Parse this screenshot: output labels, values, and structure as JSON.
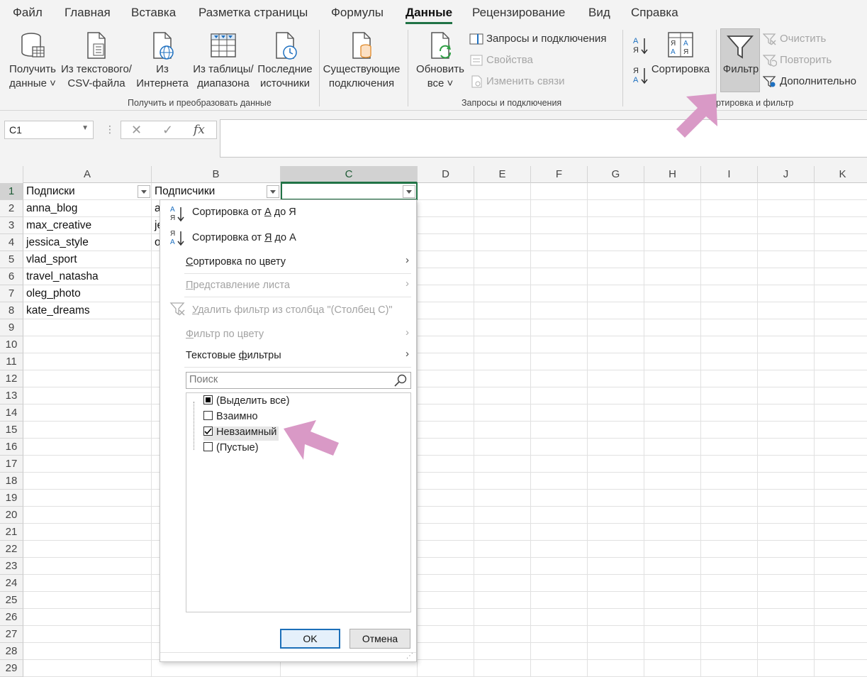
{
  "menu": {
    "tabs": [
      "Файл",
      "Главная",
      "Вставка",
      "Разметка страницы",
      "Формулы",
      "Данные",
      "Рецензирование",
      "Вид",
      "Справка"
    ],
    "active": "Данные"
  },
  "ribbon": {
    "get_data": {
      "line1": "Получить",
      "line2": "данные ˅"
    },
    "from_text": {
      "line1": "Из текстового/",
      "line2": "CSV-файла"
    },
    "from_web": {
      "line1": "Из",
      "line2": "Интернета"
    },
    "from_table": {
      "line1": "Из таблицы/",
      "line2": "диапазона"
    },
    "recent": {
      "line1": "Последние",
      "line2": "источники"
    },
    "existing": {
      "line1": "Существующие",
      "line2": "подключения"
    },
    "group1_label": "Получить и преобразовать данные",
    "refresh": {
      "line1": "Обновить",
      "line2": "все ˅"
    },
    "queries": "Запросы и подключения",
    "properties": "Свойства",
    "edit_links": "Изменить связи",
    "group2_label": "Запросы и подключения",
    "sort": "Сортировка",
    "filter": "Фильтр",
    "clear": "Очистить",
    "reapply": "Повторить",
    "advanced": "Дополнительно",
    "group3_label": "ртировка и фильтр"
  },
  "formula_bar": {
    "namebox": "C1",
    "cancel": "✕",
    "enter": "✓",
    "fx": "fx",
    "value": ""
  },
  "columns": [
    "A",
    "B",
    "C",
    "D",
    "E",
    "F",
    "G",
    "H",
    "I",
    "J",
    "K"
  ],
  "rows": [
    "1",
    "2",
    "3",
    "4",
    "5",
    "6",
    "7",
    "8",
    "9",
    "10",
    "11",
    "12",
    "13",
    "14",
    "15",
    "16",
    "17",
    "18",
    "19",
    "20",
    "21",
    "22",
    "23",
    "24",
    "25",
    "26",
    "27",
    "28",
    "29"
  ],
  "cells": {
    "A1": "Подписки",
    "B1": "Подписчики",
    "A2": "anna_blog",
    "A3": "max_creative",
    "A4": "jessica_style",
    "A5": "vlad_sport",
    "A6": "travel_natasha",
    "A7": "oleg_photo",
    "A8": "kate_dreams",
    "B2": "a",
    "B3": "je",
    "B4": "o"
  },
  "dropdown": {
    "sort_az": {
      "pre": "Сортировка от ",
      "a": "А",
      "mid": " до Я"
    },
    "sort_za": {
      "pre": "Сортировка от ",
      "a": "Я",
      "mid": " до А"
    },
    "sort_by_color": {
      "pre": "С",
      "rest": "ортировка по цвету"
    },
    "sheet_view": {
      "pre": "П",
      "rest": "редставление листа"
    },
    "clear_filter": {
      "pre": "",
      "u": "У",
      "rest": "далить фильтр из столбца \"(Столбец C)\""
    },
    "filter_by_color": {
      "pre": "Ф",
      "rest": "ильтр по цвету"
    },
    "text_filters": {
      "pre": "Текстовые ",
      "u": "ф",
      "rest": "ильтры"
    },
    "search_placeholder": "Поиск",
    "items": [
      {
        "label": "(Выделить все)",
        "state": "partial"
      },
      {
        "label": "Взаимно",
        "state": "unchecked"
      },
      {
        "label": "Невзаимный",
        "state": "checked"
      },
      {
        "label": "(Пустые)",
        "state": "unchecked"
      }
    ],
    "ok": "OK",
    "cancel": "Отмена"
  },
  "colors": {
    "accent": "#217346",
    "annotation_arrow": "#d999c6"
  }
}
